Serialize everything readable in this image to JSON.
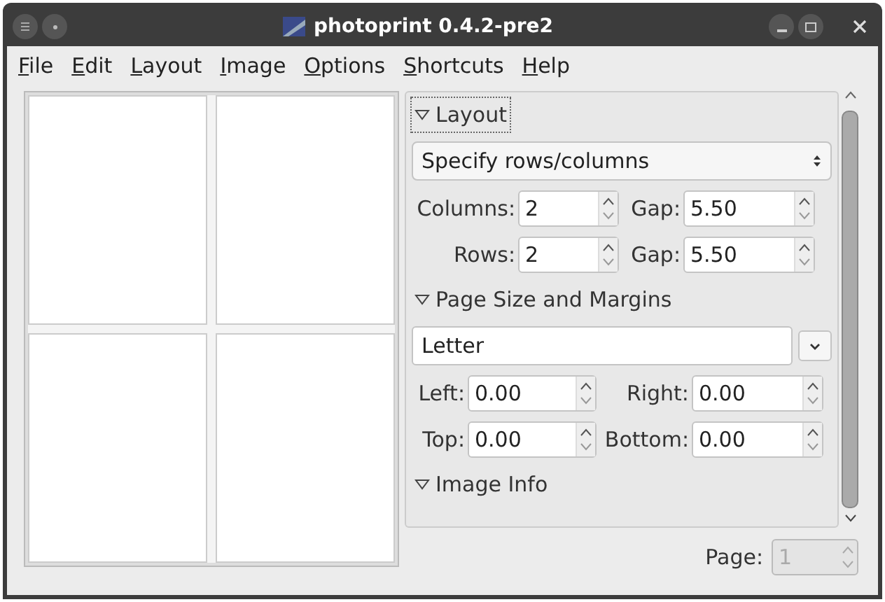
{
  "window": {
    "title": "photoprint 0.4.2-pre2"
  },
  "menu": [
    "File",
    "Edit",
    "Layout",
    "Image",
    "Options",
    "Shortcuts",
    "Help"
  ],
  "sections": [
    {
      "kind": "layout",
      "title": "Layout",
      "expanded": true,
      "focused": true,
      "mode": "Specify rows/columns",
      "fields": [
        {
          "label": "Columns:",
          "value": "2"
        },
        {
          "label": "Gap:",
          "value": "5.50"
        },
        {
          "label": "Rows:",
          "value": "2"
        },
        {
          "label": "Gap:",
          "value": "5.50"
        }
      ]
    },
    {
      "kind": "page",
      "title": "Page Size and Margins",
      "expanded": true,
      "focused": false,
      "size": "Letter",
      "fields": [
        {
          "label": "Left:",
          "value": "0.00"
        },
        {
          "label": "Right:",
          "value": "0.00"
        },
        {
          "label": "Top:",
          "value": "0.00"
        },
        {
          "label": "Bottom:",
          "value": "0.00"
        }
      ]
    },
    {
      "kind": "info",
      "title": "Image Info",
      "expanded": true,
      "focused": false
    }
  ],
  "page": {
    "label": "Page:",
    "value": "1",
    "disabled": true
  }
}
